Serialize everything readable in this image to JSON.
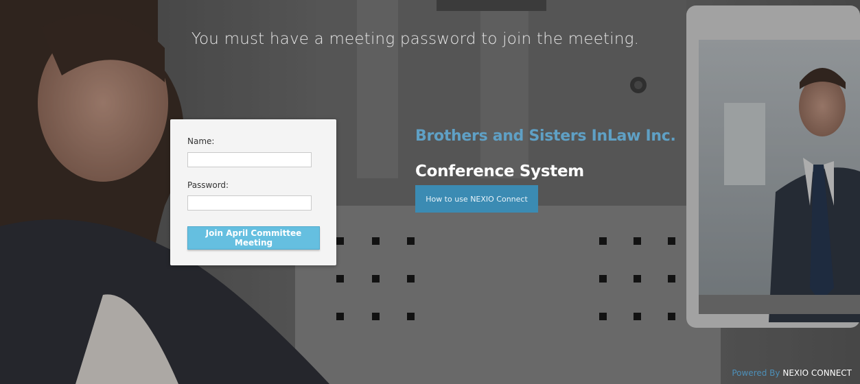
{
  "headline": "You must have a meeting password to join the meeting.",
  "form": {
    "name_label": "Name:",
    "name_value": "",
    "password_label": "Password:",
    "password_value": "",
    "join_button": "Join April Committee Meeting"
  },
  "branding": {
    "company": "Brothers and Sisters InLaw Inc.",
    "system": "Conference System",
    "howto_button": "How to use NEXIO Connect"
  },
  "footer": {
    "powered_by": "Powered By",
    "brand": "NEXIO CONNECT"
  },
  "colors": {
    "company_text": "#5fa0c5",
    "join_button_bg": "#65bfe0",
    "howto_button_bg": "#3b8bb3"
  }
}
